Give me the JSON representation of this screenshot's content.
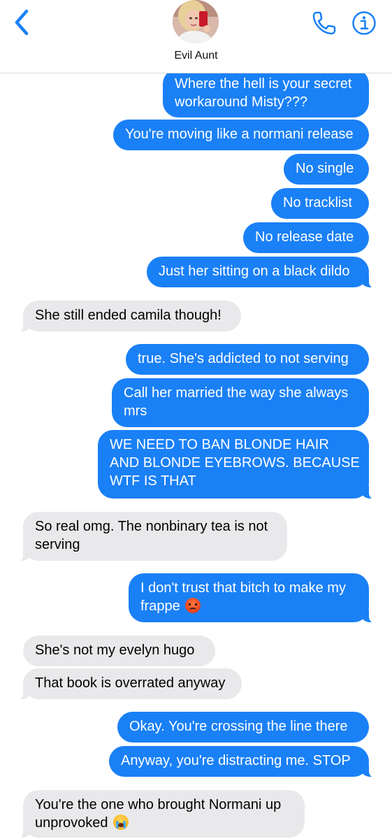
{
  "header": {
    "contact_name": "Evil Aunt",
    "back_icon": "chevron-left-icon",
    "call_icon": "phone-icon",
    "info_icon": "info-icon",
    "accent_color": "#1a80f6"
  },
  "messages": [
    {
      "sender": "me",
      "text": "Where the hell is your secret",
      "text2": "workaround Misty???"
    },
    {
      "sender": "me",
      "text": "You're moving like a normani release"
    },
    {
      "sender": "me",
      "text": "No single"
    },
    {
      "sender": "me",
      "text": "No tracklist"
    },
    {
      "sender": "me",
      "text": "No release date"
    },
    {
      "sender": "me",
      "text": "Just her sitting on a black dildo"
    },
    {
      "sender": "them",
      "text": "She still ended camila though!"
    },
    {
      "sender": "me",
      "text": "true. She's addicted to not serving"
    },
    {
      "sender": "me",
      "text": "Call her married the way she always",
      "text2": "mrs"
    },
    {
      "sender": "me",
      "text": "WE NEED TO BAN BLONDE HAIR",
      "text2": "AND BLONDE EYEBROWS. BECAUSE",
      "text3": "WTF IS THAT"
    },
    {
      "sender": "them",
      "text": "So real omg. The nonbinary tea is not",
      "text2": "serving"
    },
    {
      "sender": "me",
      "text": "I don't trust that bitch to make my",
      "text2": "frappe",
      "emoji": "angry-face"
    },
    {
      "sender": "them",
      "text": "She's not my evelyn hugo"
    },
    {
      "sender": "them",
      "text": "That book is overrated anyway"
    },
    {
      "sender": "me",
      "text": "Okay. You're crossing the line there"
    },
    {
      "sender": "me",
      "text": "Anyway, you're distracting me. STOP"
    },
    {
      "sender": "them",
      "text": "You're the one who brought Normani up",
      "text2": "unprovoked",
      "emoji": "loudly-crying-face"
    }
  ],
  "colors": {
    "outgoing_bubble": "#1a80f6",
    "incoming_bubble": "#e9e9eb"
  }
}
